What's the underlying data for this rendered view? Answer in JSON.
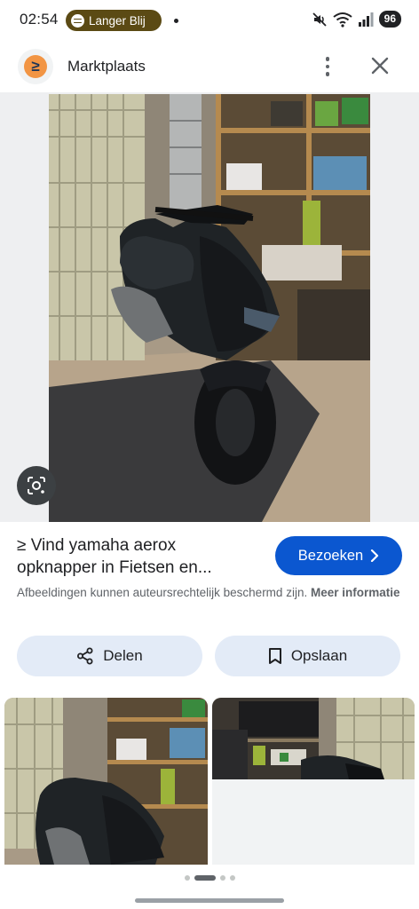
{
  "status_bar": {
    "time": "02:54",
    "media_title": "Langer Blij",
    "battery": "96"
  },
  "app_bar": {
    "site_name": "Marktplaats",
    "logo_glyph": "≥",
    "more_icon": "more-vert-icon",
    "close_icon": "close-icon"
  },
  "viewer": {
    "lens_icon": "google-lens-icon"
  },
  "result": {
    "title": "≥ Vind yamaha aerox opknapper in Fietsen en...",
    "visit_label": "Bezoeken",
    "disclaimer": "Afbeeldingen kunnen auteursrechtelijk beschermd zijn.",
    "more_info": "Meer informatie"
  },
  "actions": {
    "share_label": "Delen",
    "save_label": "Opslaan"
  },
  "colors": {
    "accent": "#0b57d0",
    "tonal_button": "#e3ebf7",
    "logo_orange": "#f29544",
    "media_pill": "#5b4a14"
  },
  "pager": {
    "total": 4,
    "active": 1
  }
}
